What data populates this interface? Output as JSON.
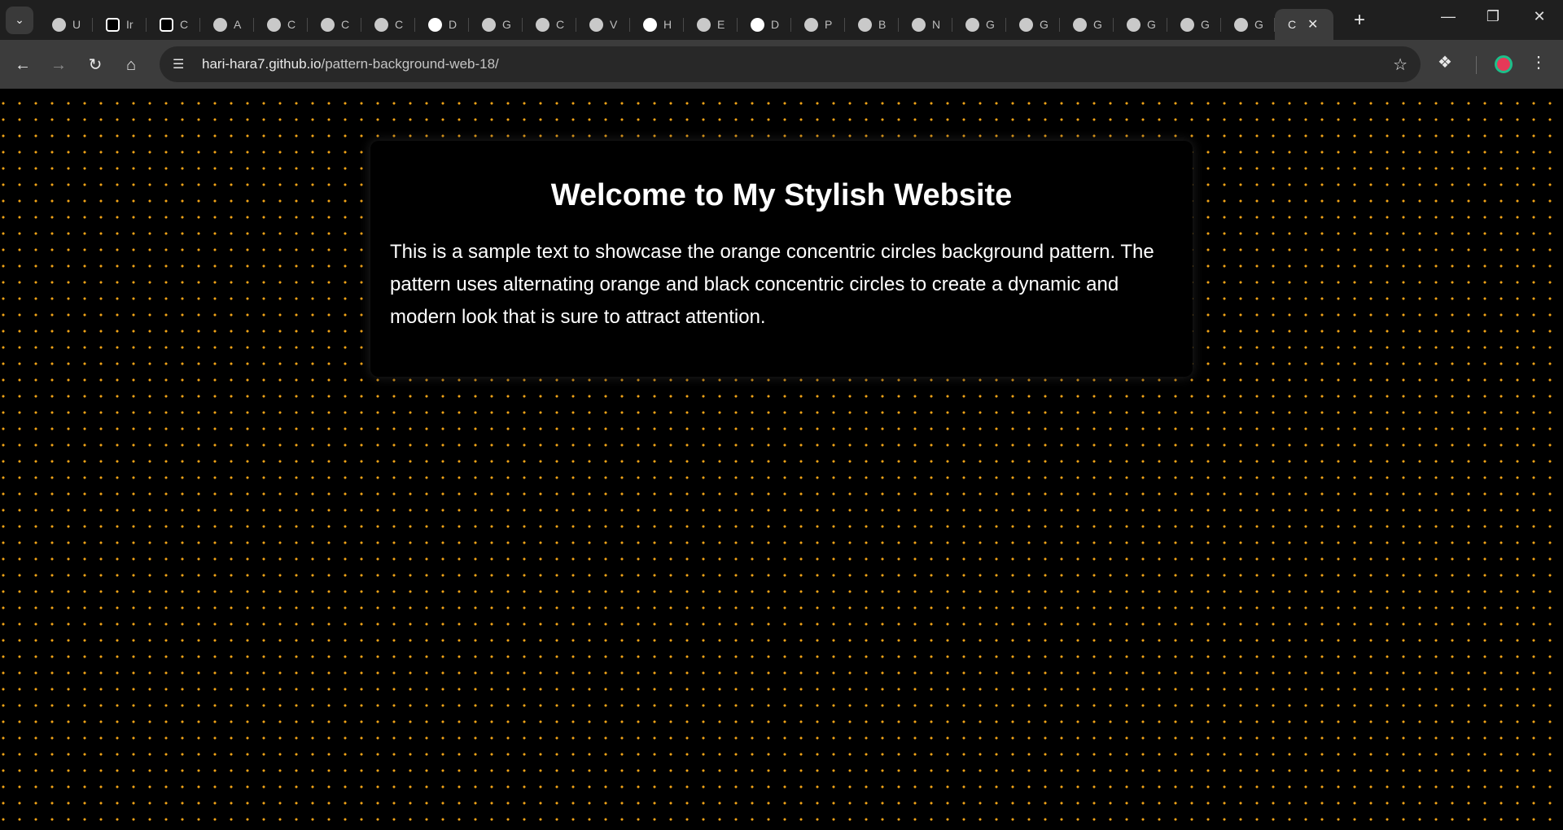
{
  "browser": {
    "tabs": [
      {
        "icon": "globe-icon",
        "label": "U"
      },
      {
        "icon": "openai-icon",
        "label": "Ir"
      },
      {
        "icon": "openai-icon",
        "label": "C"
      },
      {
        "icon": "globe-icon",
        "label": "A"
      },
      {
        "icon": "globe-icon",
        "label": "C"
      },
      {
        "icon": "globe-icon",
        "label": "C"
      },
      {
        "icon": "globe-icon",
        "label": "C"
      },
      {
        "icon": "github-icon",
        "label": "D"
      },
      {
        "icon": "globe-icon",
        "label": "G"
      },
      {
        "icon": "globe-icon",
        "label": "C"
      },
      {
        "icon": "globe-icon",
        "label": "V"
      },
      {
        "icon": "github-icon",
        "label": "H"
      },
      {
        "icon": "globe-icon",
        "label": "E"
      },
      {
        "icon": "github-icon",
        "label": "D"
      },
      {
        "icon": "globe-icon",
        "label": "P"
      },
      {
        "icon": "globe-icon",
        "label": "B"
      },
      {
        "icon": "globe-icon",
        "label": "N"
      },
      {
        "icon": "globe-icon",
        "label": "G"
      },
      {
        "icon": "globe-icon",
        "label": "G"
      },
      {
        "icon": "globe-icon",
        "label": "G"
      },
      {
        "icon": "globe-icon",
        "label": "G"
      },
      {
        "icon": "globe-icon",
        "label": "G"
      },
      {
        "icon": "globe-icon",
        "label": "G"
      }
    ],
    "active_tab": {
      "label": "C"
    },
    "url": {
      "host": "hari-hara7.github.io",
      "path": "/pattern-background-web-18/"
    }
  },
  "page": {
    "title": "Welcome to My Stylish Website",
    "text": "This is a sample text to showcase the orange concentric circles background pattern. The pattern uses alternating orange and black concentric circles to create a dynamic and modern look that is sure to attract attention."
  },
  "colors": {
    "dot": "#f2a417",
    "background": "#000000",
    "chrome_dark": "#1f1f1f",
    "chrome_toolbar": "#3c3c3c"
  }
}
